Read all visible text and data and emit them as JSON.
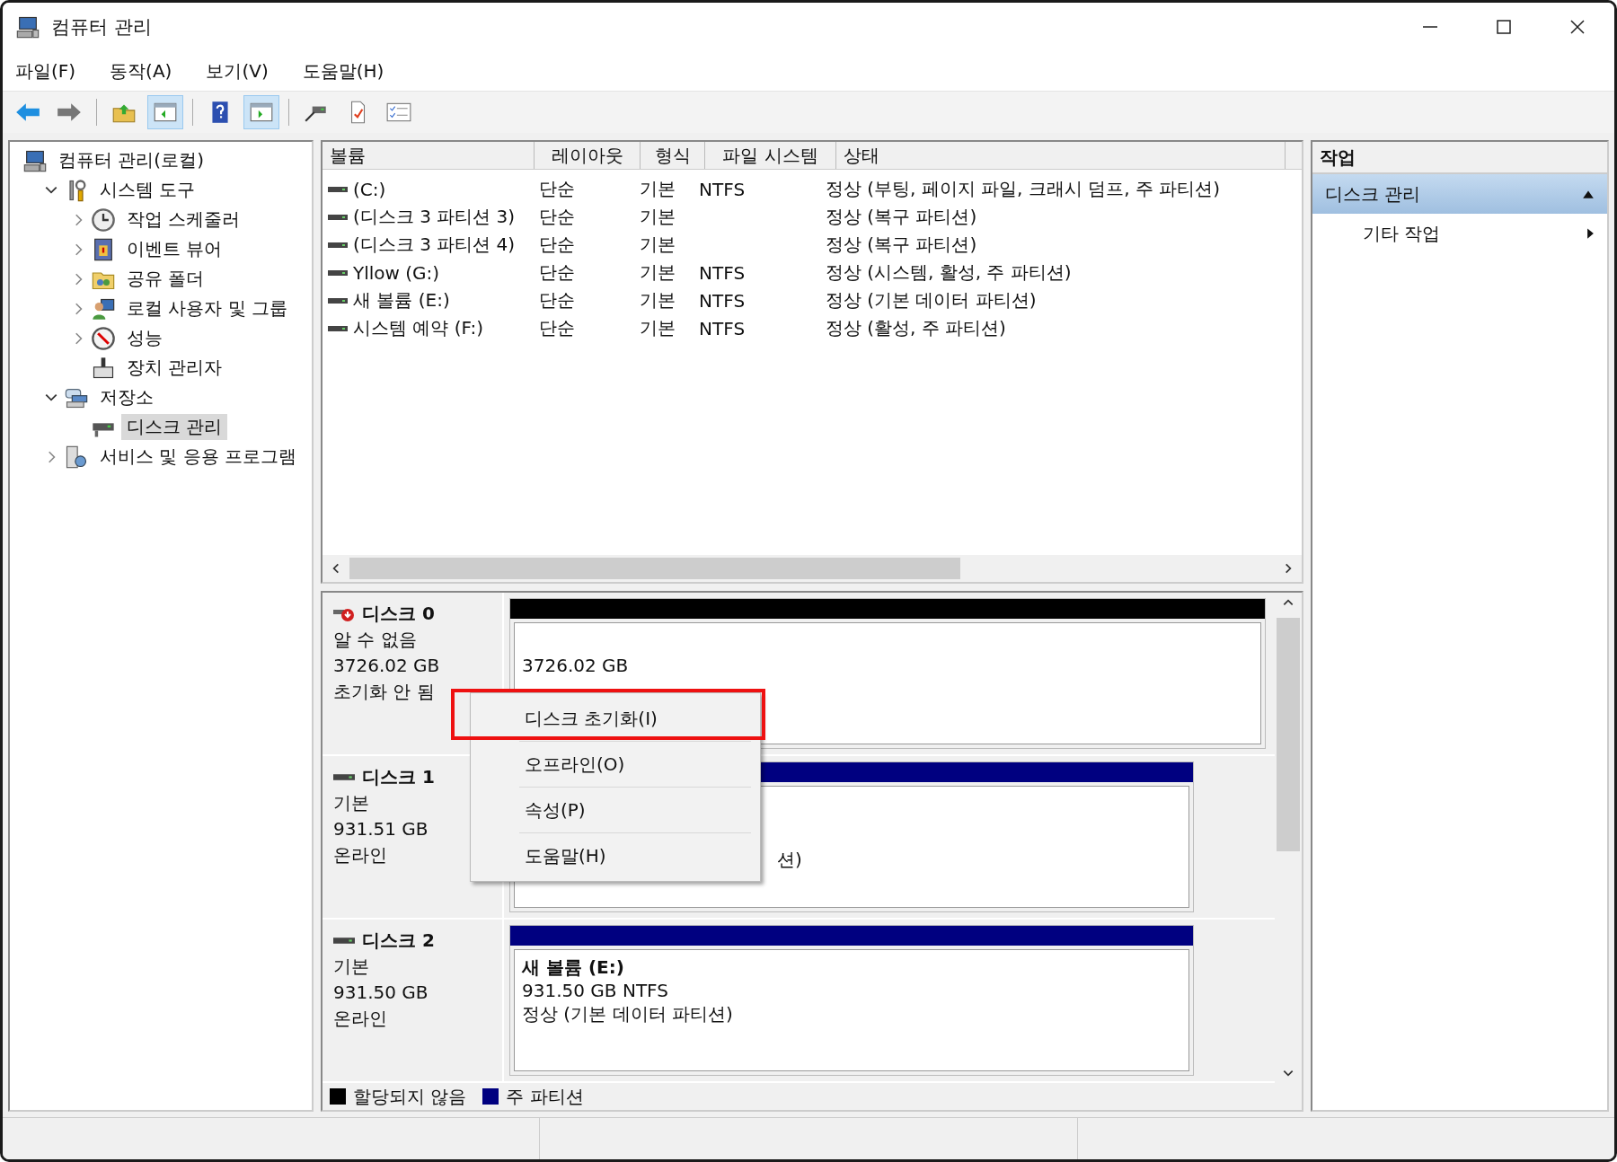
{
  "window": {
    "title": "컴퓨터 관리"
  },
  "menu": [
    "파일(F)",
    "동작(A)",
    "보기(V)",
    "도움말(H)"
  ],
  "toolbar": [
    {
      "kind": "back"
    },
    {
      "kind": "forward"
    },
    {
      "kind": "up"
    },
    {
      "kind": "tree",
      "pressed": true
    },
    {
      "kind": "help"
    },
    {
      "kind": "actions",
      "pressed": true
    },
    {
      "kind": "connect"
    },
    {
      "kind": "check"
    },
    {
      "kind": "list"
    }
  ],
  "tree": [
    {
      "label": "컴퓨터 관리(로컬)",
      "kind": "computer",
      "selected": false,
      "children": [
        {
          "label": "시스템 도구",
          "kind": "tools",
          "expanded": true,
          "selected": false,
          "children": [
            {
              "label": "작업 스케줄러",
              "kind": "clock",
              "expanded": false,
              "selected": false
            },
            {
              "label": "이벤트 뷰어",
              "kind": "event",
              "expanded": false,
              "selected": false
            },
            {
              "label": "공유 폴더",
              "kind": "folder",
              "expanded": false,
              "selected": false
            },
            {
              "label": "로컬 사용자 및 그룹",
              "kind": "users",
              "expanded": false,
              "selected": false
            },
            {
              "label": "성능",
              "kind": "gauge",
              "expanded": false,
              "selected": false
            },
            {
              "label": "장치 관리자",
              "kind": "device",
              "selected": false
            }
          ]
        },
        {
          "label": "저장소",
          "kind": "storage",
          "expanded": true,
          "selected": false,
          "children": [
            {
              "label": "디스크 관리",
              "kind": "disk",
              "selected": true
            }
          ]
        },
        {
          "label": "서비스 및 응용 프로그램",
          "kind": "services",
          "expanded": false,
          "selected": false
        }
      ]
    }
  ],
  "table": {
    "columns": [
      "볼륨",
      "레이아웃",
      "형식",
      "파일 시스템",
      "상태"
    ],
    "rows": [
      [
        " (C:)",
        "단순",
        "기본",
        "NTFS",
        "정상 (부팅, 페이지 파일, 크래시 덤프, 주 파티션)"
      ],
      [
        "(디스크 3 파티션 3)",
        "단순",
        "기본",
        "",
        "정상 (복구 파티션)"
      ],
      [
        "(디스크 3 파티션 4)",
        "단순",
        "기본",
        "",
        "정상 (복구 파티션)"
      ],
      [
        "Yllow (G:)",
        "단순",
        "기본",
        "NTFS",
        "정상 (시스템, 활성, 주 파티션)"
      ],
      [
        "새 볼륨 (E:)",
        "단순",
        "기본",
        "NTFS",
        "정상 (기본 데이터 파티션)"
      ],
      [
        "시스템 예약 (F:)",
        "단순",
        "기본",
        "NTFS",
        "정상 (활성, 주 파티션)"
      ]
    ]
  },
  "disks": [
    {
      "name": "디스크 0",
      "kind": "unknown",
      "lines": [
        "알 수 없음",
        "3726.02 GB",
        "초기화 안 됨"
      ],
      "partition": {
        "color": "#000000",
        "lines": [
          "3726.02 GB"
        ]
      }
    },
    {
      "name": "디스크 1",
      "kind": "basic",
      "lines": [
        "기본",
        "931.51 GB",
        "온라인"
      ],
      "partition": {
        "color": "#000080",
        "lines": [
          "션)"
        ]
      }
    },
    {
      "name": "디스크 2",
      "kind": "basic",
      "lines": [
        "기본",
        "931.50 GB",
        "온라인"
      ],
      "partition": {
        "color": "#000080",
        "title": "새 볼륨  (E:)",
        "lines": [
          "931.50 GB NTFS",
          "정상 (기본 데이터 파티션)"
        ]
      }
    }
  ],
  "legend": [
    {
      "label": "할당되지 않음",
      "color": "#000000"
    },
    {
      "label": "주 파티션",
      "color": "#000080"
    }
  ],
  "context_menu": [
    {
      "label": "디스크 초기화(I)",
      "annotated": true
    },
    {
      "label": "오프라인(O)",
      "annotated": false
    },
    {
      "label": "속성(P)",
      "annotated": false
    },
    {
      "label": "도움말(H)",
      "annotated": false
    }
  ],
  "actions": {
    "title": "작업",
    "section": {
      "label": "디스크 관리",
      "expanded": true
    },
    "items": [
      "기타 작업"
    ]
  }
}
